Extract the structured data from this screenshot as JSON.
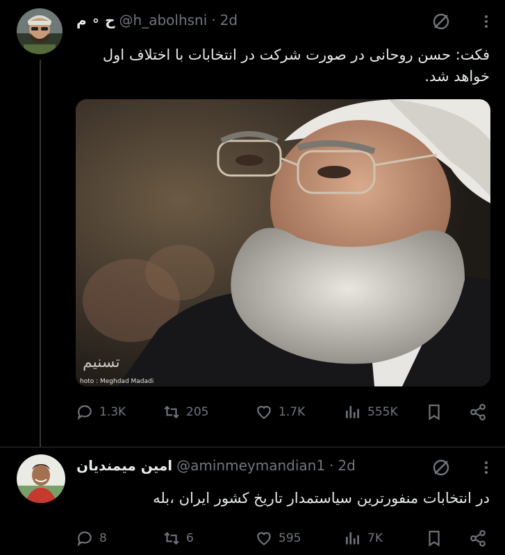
{
  "tweet1": {
    "display_name": "ح ∘ م",
    "handle": "@h_abolhsni",
    "separator": "·",
    "time": "2d",
    "text_line1": "فکت: حسن روحانی در صورت شرکت در انتخابات با اختلاف اول",
    "text_line2": "خواهد شد.",
    "photo_credit": "hoto : Meghdad Madadi",
    "actions": {
      "replies": "1.3K",
      "retweets": "205",
      "likes": "1.7K",
      "views": "555K"
    }
  },
  "tweet2": {
    "display_name": "امین میمندیان",
    "handle": "@aminmeymandian1",
    "separator": "·",
    "time": "2d",
    "text": "در انتخابات منفورترین سیاستمدار تاریخ کشور ایران ،بله",
    "actions": {
      "replies": "8",
      "retweets": "6",
      "likes": "595",
      "views": "7K"
    }
  },
  "colors": {
    "background": "#000000",
    "text": "#e7e9ea",
    "muted": "#71767b",
    "divider": "#2f3336"
  },
  "icons": [
    "grok-icon",
    "more-icon",
    "reply-icon",
    "retweet-icon",
    "like-icon",
    "views-icon",
    "bookmark-icon",
    "share-icon"
  ]
}
